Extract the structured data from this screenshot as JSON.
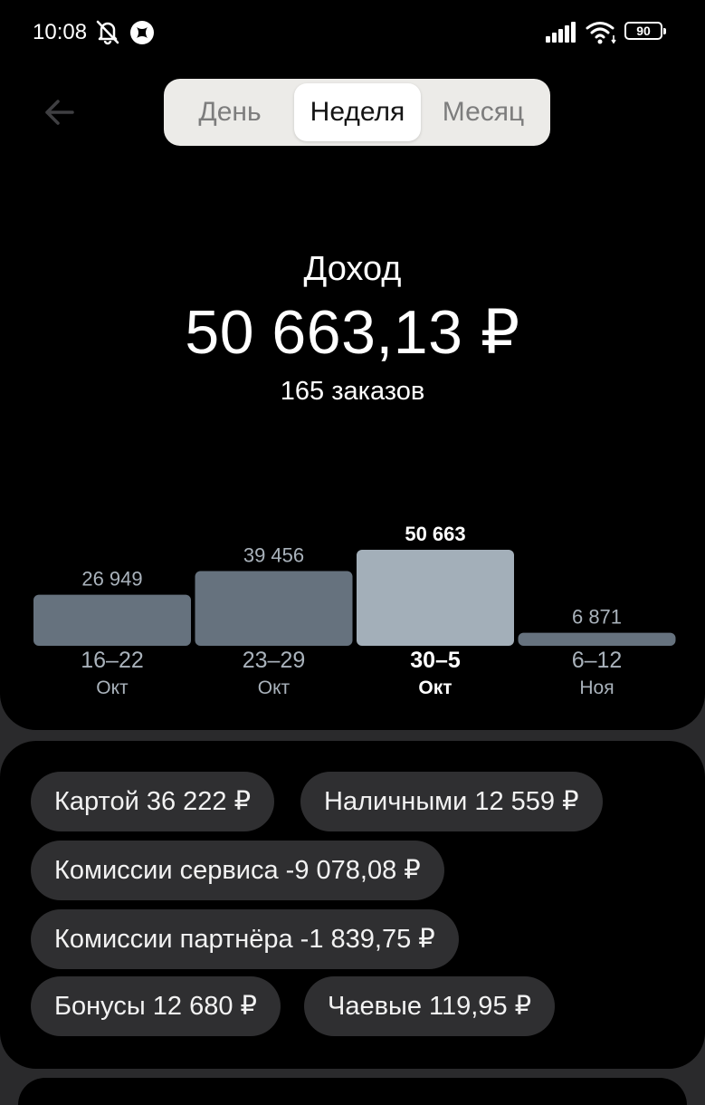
{
  "status_bar": {
    "time": "10:08",
    "battery": "90"
  },
  "tabs": [
    {
      "label": "День",
      "selected": false
    },
    {
      "label": "Неделя",
      "selected": true
    },
    {
      "label": "Месяц",
      "selected": false
    }
  ],
  "summary": {
    "label": "Доход",
    "amount": "50 663,13 ₽",
    "orders": "165 заказов"
  },
  "chart_data": {
    "type": "bar",
    "categories": [
      "16–22 Окт",
      "23–29 Окт",
      "30–5 Окт",
      "6–12 Ноя"
    ],
    "range_labels": [
      "16–22",
      "23–29",
      "30–5",
      "6–12"
    ],
    "month_labels": [
      "Окт",
      "Окт",
      "Окт",
      "Ноя"
    ],
    "values": [
      26949,
      39456,
      50663,
      6871
    ],
    "value_labels": [
      "26 949",
      "39 456",
      "50 663",
      "6 871"
    ],
    "selected_index": 2,
    "colors": {
      "bar": "#66727e",
      "selected_bar": "#a3afb9",
      "label": "#a9b2bb",
      "selected_label": "#ffffff"
    }
  },
  "breakdown": {
    "card": "Картой 36 222 ₽",
    "cash": "Наличными 12 559 ₽",
    "service_fee": "Комиссии сервиса -9 078,08 ₽",
    "partner_fee": "Комиссии партнёра -1 839,75 ₽",
    "bonuses": "Бонусы 12 680 ₽",
    "tips": "Чаевые 119,95 ₽"
  }
}
